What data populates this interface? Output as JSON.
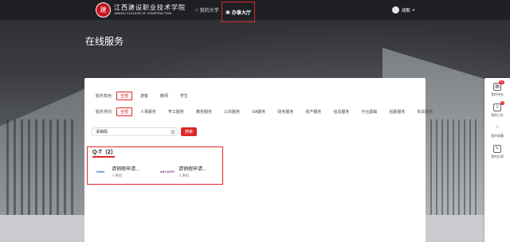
{
  "header": {
    "school_name_cn": "江西建设职业技术学院",
    "school_name_en": "JIANGXI COLLEGE OF CONSTRUCTION",
    "seal_char": "建",
    "nav_my": "我的大学",
    "nav_hall": "办事大厅",
    "user_name": "胡斯"
  },
  "page": {
    "title": "在线服务"
  },
  "filters": {
    "role_label": "服务角色:",
    "roles": [
      "全部",
      "游客",
      "教师",
      "学生"
    ],
    "active_role": "全部",
    "category_label": "服务类别:",
    "categories": [
      "全部",
      "人事服务",
      "学工服务",
      "教务服务",
      "公共服务",
      "OA服务",
      "财务服务",
      "资产服务",
      "信息服务",
      "平台基础",
      "后勤服务",
      "实训服务"
    ],
    "active_category": "全部"
  },
  "search": {
    "value": "请销假",
    "button": "搜索",
    "clear_glyph": "×"
  },
  "results": {
    "group_title": "Q-T（2）",
    "items": [
      {
        "name": "请销假申请...",
        "dept": "人事处",
        "logo": "Kaimi"
      },
      {
        "name": "请销假申请...",
        "dept": "人事处",
        "logo": "ANY AUTH"
      }
    ]
  },
  "side_panel": {
    "items": [
      {
        "label": "我的待办",
        "icon": "calendar-icon",
        "glyph": "▦",
        "badge": "12"
      },
      {
        "label": "我的已办",
        "icon": "document-icon",
        "glyph": "≡",
        "badge": "3"
      },
      {
        "label": "我的收藏",
        "icon": "star-icon",
        "glyph": "☆",
        "badge": ""
      },
      {
        "label": "我的反馈",
        "icon": "feedback-icon",
        "glyph": "✎",
        "badge": ""
      }
    ]
  },
  "colors": {
    "accent": "#e0262c",
    "header_bg": "#141416"
  }
}
